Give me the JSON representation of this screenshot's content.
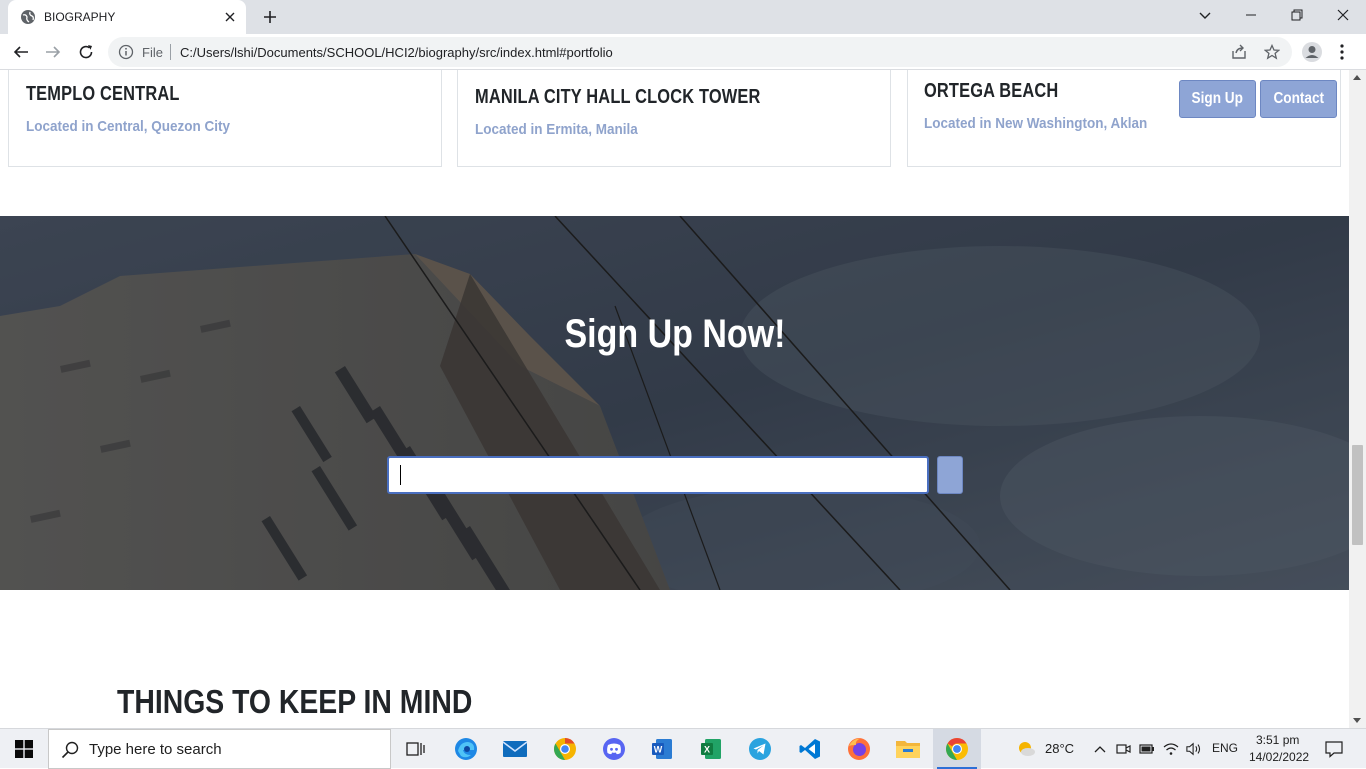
{
  "browser": {
    "tab_title": "BIOGRAPHY",
    "omnibox_scheme": "File",
    "url": "C:/Users/lshi/Documents/SCHOOL/HCI2/biography/src/index.html#portfolio"
  },
  "page": {
    "cards": [
      {
        "title": "TEMPLO CENTRAL",
        "location": "Located in Central, Quezon City"
      },
      {
        "title": "MANILA CITY HALL CLOCK TOWER",
        "location": "Located in Ermita, Manila"
      },
      {
        "title": "ORTEGA BEACH",
        "location": "Located in New Washington, Aklan"
      }
    ],
    "nav_buttons": {
      "signup": "Sign Up",
      "contact": "Contact"
    },
    "signup": {
      "title": "Sign Up Now!",
      "email_value": ""
    },
    "things_heading": "THINGS TO KEEP IN MIND"
  },
  "taskbar": {
    "search_placeholder": "Type here to search",
    "weather": "28°C",
    "language": "ENG",
    "time": "3:51 pm",
    "date": "14/02/2022",
    "apps": [
      "task-view",
      "edge",
      "mail",
      "chrome-canary",
      "discord",
      "word",
      "excel",
      "telegram",
      "vscode",
      "firefox",
      "file-explorer",
      "chrome"
    ]
  },
  "colors": {
    "accent": "#8ea5d6",
    "location_text": "#8fa3cc",
    "signup_bg": "#464f5d"
  }
}
